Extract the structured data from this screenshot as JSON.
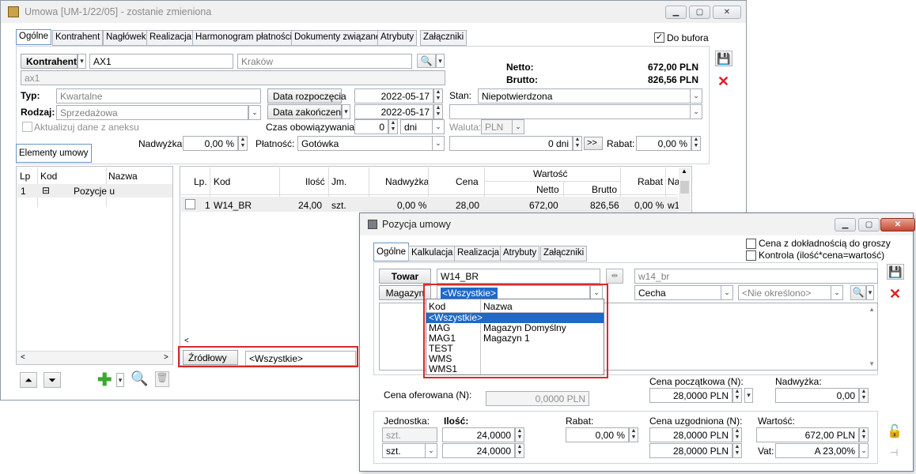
{
  "main": {
    "title": "Umowa [UM-1/22/05] - zostanie zmieniona",
    "tabs": [
      "Ogólne",
      "Kontrahent",
      "Nagłówek",
      "Realizacja",
      "Harmonogram płatności",
      "Dokumenty związane",
      "Atrybuty",
      "Załączniki"
    ],
    "do_bufora": "Do bufora",
    "kontrahent_btn": "Kontrahent",
    "kontrahent_code": "AX1",
    "kontrahent_city": "Kraków",
    "kontrahent_name": "ax1",
    "netto_label": "Netto:",
    "netto_value": "672,00 PLN",
    "brutto_label": "Brutto:",
    "brutto_value": "826,56 PLN",
    "typ_label": "Typ:",
    "typ_value": "Kwartalne",
    "rodzaj_label": "Rodzaj:",
    "rodzaj_value": "Sprzedażowa",
    "aktualizuj": "Aktualizuj dane z aneksu",
    "data_rozp_btn": "Data rozpoczęcia",
    "data_rozp": "2022-05-17",
    "data_zak_btn": "Data zakończenia",
    "data_zak": "2022-05-17",
    "czas_label": "Czas obowiązywania:",
    "czas_value": "0",
    "czas_unit": "dni",
    "stan_label": "Stan:",
    "stan_value": "Niepotwierdzona",
    "waluta_label": "Waluta:",
    "waluta_value": "PLN",
    "nadwyzka_label": "Nadwyżka:",
    "nadwyzka_value": "0,00 %",
    "platnosc_label": "Płatność:",
    "platnosc_value": "Gotówka",
    "termin_value": "0 dni",
    "termin_btn": ">>",
    "rabat_label": "Rabat:",
    "rabat_value": "0,00 %",
    "elementy_tab": "Elementy umowy",
    "tree_headers": [
      "Lp",
      "Kod",
      "Nazwa"
    ],
    "tree_row": {
      "lp": "1",
      "kod": "⊟",
      "nazwa": "Pozycje u"
    },
    "grid_headers": {
      "lp": "Lp.",
      "kod": "Kod",
      "ilosc": "Ilość",
      "jm": "Jm.",
      "nadwyzka": "Nadwyżka",
      "cena": "Cena",
      "wartosc": "Wartość",
      "netto": "Netto",
      "brutto": "Brutto",
      "rabat": "Rabat",
      "na": "Na"
    },
    "grid_row": {
      "lp": "1",
      "kod": "W14_BR",
      "ilosc": "24,00",
      "jm": "szt.",
      "nadwyzka": "0,00 %",
      "cena": "28,00",
      "netto": "672,00",
      "brutto": "826,56",
      "rabat": "0,00 %",
      "na": "w1"
    },
    "zrodlowy_btn": "Źródłowy",
    "zrodlowy_value": "<Wszystkie>"
  },
  "dialog": {
    "title": "Pozycja umowy",
    "tabs": [
      "Ogólne",
      "Kalkulacja",
      "Realizacja",
      "Atrybuty",
      "Załączniki"
    ],
    "cena_dokl": "Cena z dokładnością do groszy",
    "kontrola": "Kontrola (ilość*cena=wartość)",
    "towar_btn": "Towar",
    "towar_code": "W14_BR",
    "towar_name": "w14_br",
    "magazyn_btn": "Magazyn",
    "magazyn_value": "<Wszystkie>",
    "cecha_value": "Cecha",
    "cecha_choice": "<Nie określono>",
    "dropdown_headers": [
      "Kod",
      "Nazwa"
    ],
    "dropdown_rows": [
      {
        "kod": "<Wszystkie>",
        "nazwa": ""
      },
      {
        "kod": "MAG",
        "nazwa": "Magazyn Domyślny"
      },
      {
        "kod": "MAG1",
        "nazwa": "Magazyn 1"
      },
      {
        "kod": "TEST",
        "nazwa": ""
      },
      {
        "kod": "WMS",
        "nazwa": ""
      },
      {
        "kod": "WMS1",
        "nazwa": ""
      }
    ],
    "cena_pocz_label": "Cena początkowa (N):",
    "cena_pocz_value": "28,0000 PLN",
    "nadwyzka_label": "Nadwyżka:",
    "nadwyzka_value": "0,00",
    "cena_ofer_label": "Cena oferowana (N):",
    "cena_ofer_value": "0,0000 PLN",
    "jednostka_label": "Jednostka:",
    "ilosc_label": "Ilość:",
    "rabat_label": "Rabat:",
    "cena_uzg_label": "Cena uzgodniona (N):",
    "wartosc_label": "Wartość:",
    "jm1": "szt.",
    "ilosc1": "24,0000",
    "rabat_value": "0,00 %",
    "cena_uzg1": "28,0000 PLN",
    "wartosc_value": "672,00 PLN",
    "jm2": "szt.",
    "ilosc2": "24,0000",
    "cena_uzg2": "28,0000 PLN",
    "vat_label": "Vat:",
    "vat_value": "A 23,00%"
  }
}
